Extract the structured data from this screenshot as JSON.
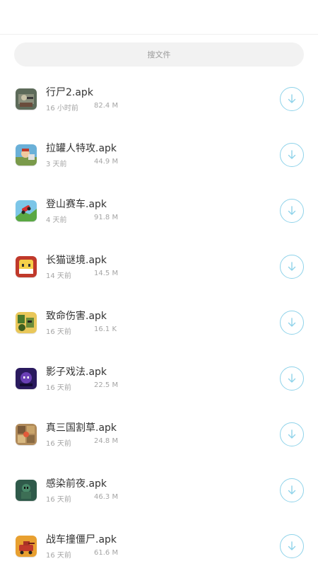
{
  "search": {
    "placeholder": "搜文件"
  },
  "colors": {
    "accent": "#8fd3ea",
    "secondary_text": "#a5a5a5",
    "primary_text": "#333333"
  },
  "files": [
    {
      "name": "行尸2.apk",
      "time": "16 小时前",
      "size": "82.4 M",
      "icon": "zombie-game-icon"
    },
    {
      "name": "拉罐人特攻.apk",
      "time": "3 天前",
      "size": "44.9 M",
      "icon": "can-man-game-icon"
    },
    {
      "name": "登山赛车.apk",
      "time": "4 天前",
      "size": "91.8 M",
      "icon": "hill-racing-game-icon"
    },
    {
      "name": "长猫谜境.apk",
      "time": "14 天前",
      "size": "14.5 M",
      "icon": "long-cat-game-icon"
    },
    {
      "name": "致命伤害.apk",
      "time": "16 天前",
      "size": "16.1 K",
      "icon": "lethal-damage-game-icon"
    },
    {
      "name": "影子戏法.apk",
      "time": "16 天前",
      "size": "22.5 M",
      "icon": "shadow-trick-game-icon"
    },
    {
      "name": "真三国割草.apk",
      "time": "16 天前",
      "size": "24.8 M",
      "icon": "three-kingdoms-game-icon"
    },
    {
      "name": "感染前夜.apk",
      "time": "16 天前",
      "size": "46.3 M",
      "icon": "infection-eve-game-icon"
    },
    {
      "name": "战车撞僵尸.apk",
      "time": "16 天前",
      "size": "61.6 M",
      "icon": "tank-zombie-game-icon"
    }
  ]
}
